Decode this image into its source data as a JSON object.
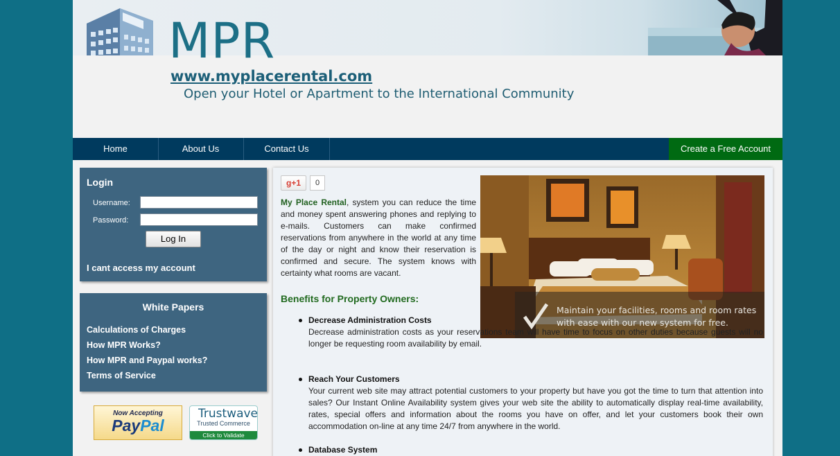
{
  "header": {
    "logo_text": "MPR",
    "site_url": "www.myplacerental.com",
    "tagline": "Open your Hotel or Apartment to the International Community"
  },
  "nav": {
    "items": [
      "Home",
      "About Us",
      "Contact Us"
    ],
    "cta": "Create a Free Account"
  },
  "login": {
    "title": "Login",
    "username_label": "Username:",
    "password_label": "Password:",
    "username_value": "",
    "password_value": "",
    "button": "Log In",
    "cant_access": "I cant access my account"
  },
  "white_papers": {
    "title": "White Papers",
    "links": [
      "Calculations of Charges",
      "How MPR Works?",
      "How MPR and Paypal works?",
      "Terms of Service"
    ]
  },
  "badges": {
    "paypal_now": "Now Accepting",
    "paypal_word_a": "Pay",
    "paypal_word_b": "Pal",
    "trustwave_name": "Trustwave",
    "trustwave_sub": "Trusted Commerce",
    "trustwave_action": "Click to Validate"
  },
  "social": {
    "gplus_label": "g+1",
    "gplus_count": "0"
  },
  "main": {
    "intro_brand": "My Place Rental",
    "intro_text": ", system you can reduce the time and money spent answering phones and replying to e-mails. Customers can make confirmed reservations from anywhere in the world at any time of the day or night and know their reservation is confirmed and secure. The system knows with certainty what rooms are vacant.",
    "image_caption": "Maintain your facilities, rooms and room rates with ease with our new system for free.",
    "benefits_title": "Benefits for Property Owners:",
    "benefits": [
      {
        "title": "Decrease Administration Costs",
        "text": "Decrease administration costs as your reservations team will have time to focus on other duties because guests will no longer be requesting room availability by email."
      },
      {
        "title": "Reach Your Customers",
        "text": "Your current web site may attract potential customers to your property but have you got the time to turn that attention into sales? Our Instant Online Availability system gives your web site the ability to automatically display real-time availability, rates, special offers and information about the rooms you have on offer, and let your customers book their own accommodation on-line at any time 24/7 from anywhere in the world."
      },
      {
        "title": "Database System",
        "text": ""
      }
    ]
  },
  "colors": {
    "background": "#0f6f86",
    "nav": "#003a5e",
    "cta": "#006a12",
    "sidebar_box": "#3e6580",
    "brand_green": "#216a1f"
  }
}
